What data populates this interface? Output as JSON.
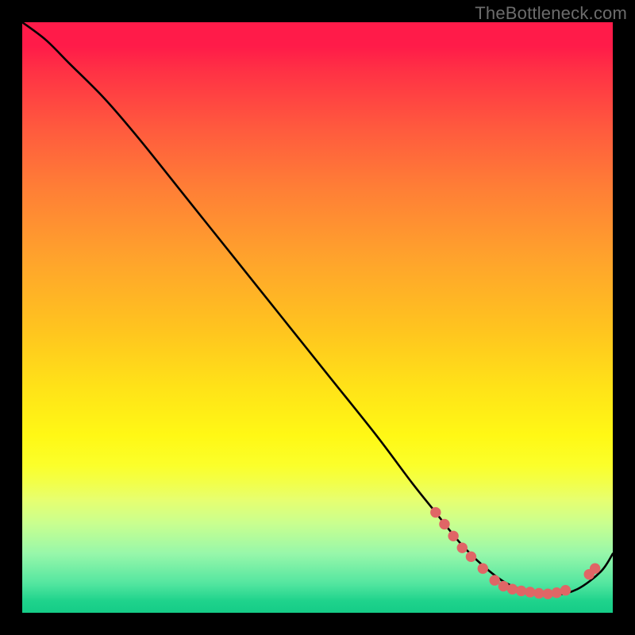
{
  "attribution": "TheBottleneck.com",
  "chart_data": {
    "type": "line",
    "title": "",
    "xlabel": "",
    "ylabel": "",
    "xlim": [
      0,
      100
    ],
    "ylim": [
      0,
      100
    ],
    "series": [
      {
        "name": "curve",
        "x": [
          0,
          4,
          8,
          14,
          20,
          28,
          36,
          44,
          52,
          60,
          66,
          70,
          74,
          78,
          82,
          86,
          90,
          94,
          98,
          100
        ],
        "y": [
          100,
          97,
          93,
          87,
          80,
          70,
          60,
          50,
          40,
          30,
          22,
          17,
          12,
          8,
          5,
          3.5,
          3,
          4,
          7,
          10
        ],
        "color": "#000000"
      }
    ],
    "markers": {
      "color": "#e06666",
      "radius_pct": 0.9,
      "points": [
        {
          "x": 70,
          "y": 17
        },
        {
          "x": 71.5,
          "y": 15
        },
        {
          "x": 73,
          "y": 13
        },
        {
          "x": 74.5,
          "y": 11
        },
        {
          "x": 76,
          "y": 9.5
        },
        {
          "x": 78,
          "y": 7.5
        },
        {
          "x": 80,
          "y": 5.5
        },
        {
          "x": 81.5,
          "y": 4.5
        },
        {
          "x": 83,
          "y": 4
        },
        {
          "x": 84.5,
          "y": 3.7
        },
        {
          "x": 86,
          "y": 3.5
        },
        {
          "x": 87.5,
          "y": 3.3
        },
        {
          "x": 89,
          "y": 3.2
        },
        {
          "x": 90.5,
          "y": 3.4
        },
        {
          "x": 92,
          "y": 3.8
        },
        {
          "x": 96,
          "y": 6.5
        },
        {
          "x": 97,
          "y": 7.5
        }
      ]
    },
    "gradient_background": true
  }
}
